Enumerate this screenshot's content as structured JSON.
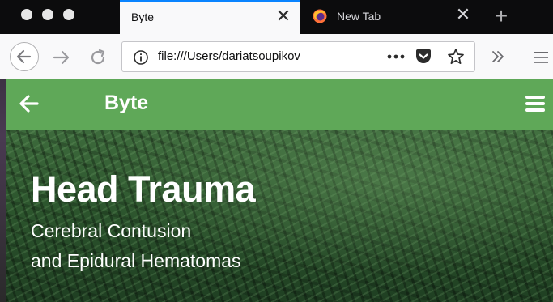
{
  "browser": {
    "tabs": [
      {
        "title": "Byte",
        "active": true
      },
      {
        "title": "New Tab",
        "active": false
      }
    ],
    "url": "file:///Users/dariatsoupikov",
    "icons": {
      "back": "arrow-left-icon",
      "forward": "arrow-right-icon",
      "reload": "reload-icon",
      "info": "info-icon",
      "page_actions": "more-dots-icon",
      "pocket": "pocket-icon",
      "bookmark": "star-icon",
      "overflow": "chevron-double-right-icon",
      "menu": "hamburger-icon"
    },
    "accent_color": "#0a84ff"
  },
  "site": {
    "header": {
      "title": "Byte",
      "background_color": "#5fa858"
    },
    "hero": {
      "title": "Head Trauma",
      "subtitle_lines": [
        "Cerebral Contusion",
        "and Epidural Hematomas"
      ]
    }
  }
}
